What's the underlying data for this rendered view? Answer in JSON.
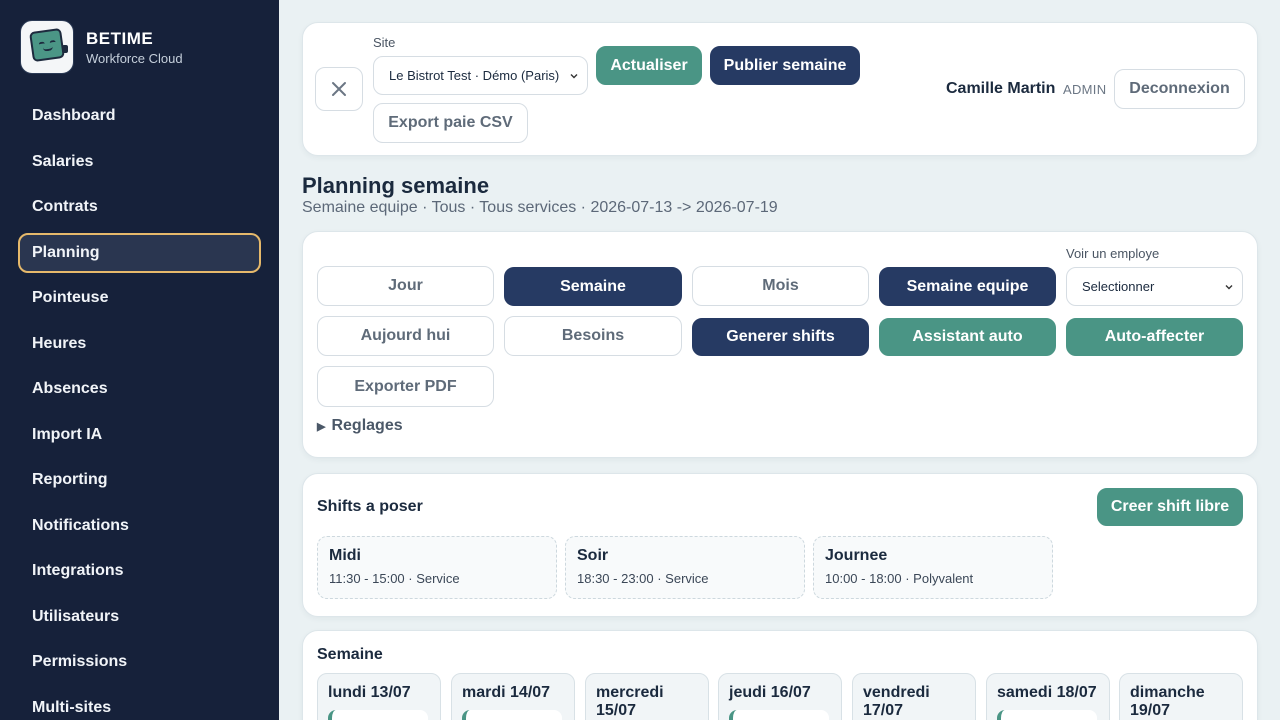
{
  "brand": {
    "name": "BETIME",
    "subtitle": "Workforce Cloud"
  },
  "sidebar": {
    "items": [
      {
        "label": "Dashboard"
      },
      {
        "label": "Salaries"
      },
      {
        "label": "Contrats"
      },
      {
        "label": "Planning",
        "active": true
      },
      {
        "label": "Pointeuse"
      },
      {
        "label": "Heures"
      },
      {
        "label": "Absences"
      },
      {
        "label": "Import IA"
      },
      {
        "label": "Reporting"
      },
      {
        "label": "Notifications"
      },
      {
        "label": "Integrations"
      },
      {
        "label": "Utilisateurs"
      },
      {
        "label": "Permissions"
      },
      {
        "label": "Multi-sites"
      }
    ]
  },
  "topbar": {
    "site_label": "Site",
    "site_value": "Le Bistrot Test · Démo (Paris)",
    "refresh_label": "Actualiser",
    "publish_label": "Publier semaine",
    "export_label": "Export paie CSV",
    "user_name": "Camille Martin",
    "user_role": "ADMIN",
    "logout_label": "Deconnexion"
  },
  "page": {
    "title": "Planning semaine",
    "subtitle": "Semaine equipe · Tous · Tous services · 2026-07-13 -> 2026-07-19"
  },
  "controls": {
    "jour": "Jour",
    "semaine": "Semaine",
    "mois": "Mois",
    "semaine_equipe": "Semaine equipe",
    "voir_label": "Voir un employe",
    "voir_value": "Selectionner",
    "aujourdhui": "Aujourd hui",
    "besoins": "Besoins",
    "generer": "Generer shifts",
    "assistant": "Assistant auto",
    "auto_affecter": "Auto-affecter",
    "exporter_pdf": "Exporter PDF",
    "reglages": "Reglages"
  },
  "shifts": {
    "title": "Shifts a poser",
    "create_label": "Creer shift libre",
    "items": [
      {
        "name": "Midi",
        "detail": "11:30 - 15:00 · Service"
      },
      {
        "name": "Soir",
        "detail": "18:30 - 23:00 · Service"
      },
      {
        "name": "Journee",
        "detail": "10:00 - 18:00 · Polyvalent"
      }
    ]
  },
  "week": {
    "title": "Semaine",
    "days": [
      {
        "label": "lundi 13/07"
      },
      {
        "label": "mardi 14/07"
      },
      {
        "label": "mercredi 15/07"
      },
      {
        "label": "jeudi 16/07"
      },
      {
        "label": "vendredi 17/07"
      },
      {
        "label": "samedi 18/07"
      },
      {
        "label": "dimanche 19/07"
      }
    ]
  },
  "colors": {
    "sidebar": "#16213a",
    "navy": "#263a63",
    "teal": "#4a9585",
    "active_border": "#e6b96b"
  }
}
